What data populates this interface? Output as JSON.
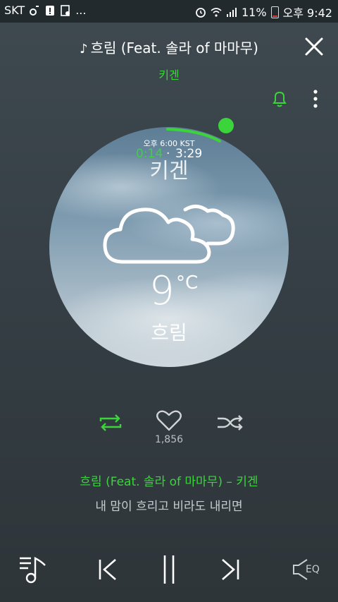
{
  "status": {
    "carrier": "SKT",
    "battery": "11%",
    "time": "오후 9:42",
    "dots": "..."
  },
  "player": {
    "song_title": "흐림 (Feat. 솔라 of 마마무)",
    "artist": "키겐",
    "time_label": "오후 6:00 KST",
    "current_time": "0:14",
    "separator": "·",
    "total_time": "3:29",
    "progress_fraction": 0.067,
    "temperature": "9",
    "temperature_unit": "°C",
    "condition": "흐림",
    "likes": "1,856",
    "now_playing": "흐림 (Feat. 솔라 of 마마무) – 키겐",
    "lyric": "내 맘이 흐리고 비라도 내리면"
  },
  "icons": {
    "accent": "#3bd43b",
    "eq_label": "EQ"
  }
}
